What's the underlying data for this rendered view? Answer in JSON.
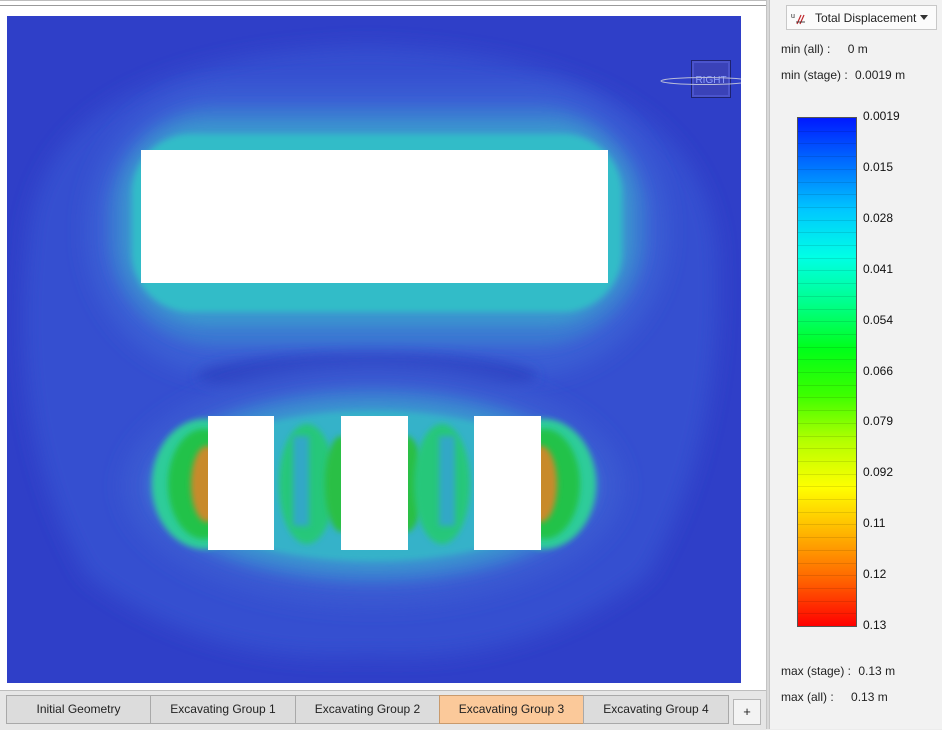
{
  "legend": {
    "result_selector": {
      "label": "Total Displacement",
      "icon": "displacement-icon"
    },
    "min_all": {
      "label": "min (all) :",
      "value": "0 m"
    },
    "min_stage": {
      "label": "min (stage) :",
      "value": "0.0019 m"
    },
    "max_stage": {
      "label": "max (stage) :",
      "value": "0.13 m"
    },
    "max_all": {
      "label": "max (all) :",
      "value": "0.13 m"
    },
    "ticks": [
      "0.0019",
      "0.015",
      "0.028",
      "0.041",
      "0.054",
      "0.066",
      "0.079",
      "0.092",
      "0.11",
      "0.12",
      "0.13"
    ],
    "color_stops": [
      "#0019ff",
      "#0070ff",
      "#00c8ff",
      "#00ffe6",
      "#00ff8c",
      "#00ff19",
      "#3cff00",
      "#b4ff00",
      "#ffff00",
      "#ffb400",
      "#ff6400",
      "#ff0000"
    ]
  },
  "view_cube": {
    "label": "RIGHT"
  },
  "stages": {
    "tabs": [
      {
        "label": "Initial Geometry",
        "active": false
      },
      {
        "label": "Excavating Group 1",
        "active": false
      },
      {
        "label": "Excavating Group 2",
        "active": false
      },
      {
        "label": "Excavating Group 3",
        "active": true
      },
      {
        "label": "Excavating Group 4",
        "active": false
      }
    ],
    "add_label": "+"
  },
  "colors": {
    "background_blue": "#2f3fc8",
    "active_tab": "#fbc99a"
  }
}
